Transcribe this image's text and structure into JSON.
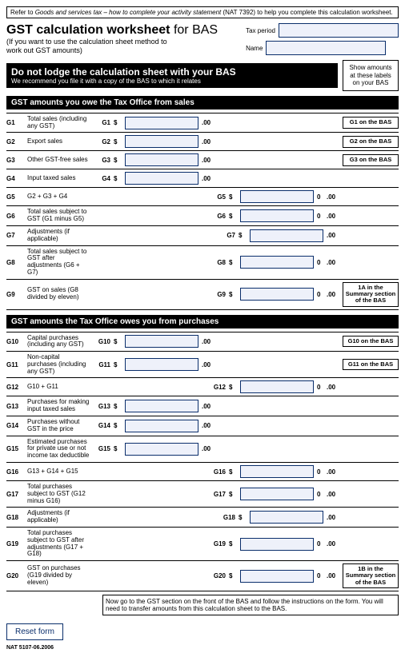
{
  "hint_pre": "Refer to ",
  "hint_em": "Goods and services tax – how to complete your activity statement",
  "hint_post": " (NAT 7392) to help you complete this calculation worksheet.",
  "title_bold": "GST calculation worksheet",
  "title_rest": " for BAS",
  "subtitle": "(If you want to use the calculation sheet method to work out GST amounts)",
  "taxperiod_label": "Tax period",
  "name_label": "Name",
  "warn_h": "Do not lodge the calculation sheet with your BAS",
  "warn_s": "We recommend you file it with a copy of the BAS to which it relates",
  "sidebox": "Show amounts at these labels on your BAS",
  "section1": "GST amounts you owe the Tax Office from sales",
  "section2": "GST amounts the Tax Office owes you from purchases",
  "dollar": "$",
  "cents": ".00",
  "zero": "0",
  "rows1": [
    {
      "g": "G1",
      "d": "Total sales (including any GST)",
      "rl": "G1",
      "lt": "left",
      "b": "G1 on the BAS"
    },
    {
      "g": "G2",
      "d": "Export sales",
      "rl": "G2",
      "lt": "left",
      "b": "G2 on the BAS"
    },
    {
      "g": "G3",
      "d": "Other GST-free sales",
      "rl": "G3",
      "lt": "left",
      "b": "G3 on the BAS"
    },
    {
      "g": "G4",
      "d": "Input taxed sales",
      "rl": "G4",
      "lt": "left",
      "b": ""
    },
    {
      "g": "G5",
      "d": "G2 + G3 + G4",
      "rl": "G5",
      "lt": "right",
      "b": "",
      "calc": true
    },
    {
      "g": "G6",
      "d": "Total sales subject to GST\n(G1 minus G5)",
      "rl": "G6",
      "lt": "right",
      "b": "",
      "calc": true
    },
    {
      "g": "G7",
      "d": "Adjustments (if applicable)",
      "rl": "G7",
      "lt": "right",
      "b": ""
    },
    {
      "g": "G8",
      "d": "Total sales subject to GST after adjustments\n(G6 + G7)",
      "rl": "G8",
      "lt": "right",
      "b": "",
      "calc": true
    },
    {
      "g": "G9",
      "d": "GST on sales (G8 divided by eleven)",
      "rl": "G9",
      "lt": "right",
      "b": "1A in the Summary section of the BAS",
      "calc": true
    }
  ],
  "rows2": [
    {
      "g": "G10",
      "d": "Capital purchases\n(including any GST)",
      "rl": "G10",
      "lt": "left",
      "b": "G10 on the BAS"
    },
    {
      "g": "G11",
      "d": "Non-capital purchases\n(including any GST)",
      "rl": "G11",
      "lt": "left",
      "b": "G11 on the BAS"
    },
    {
      "g": "G12",
      "d": "G10 + G11",
      "rl": "G12",
      "lt": "right",
      "b": "",
      "calc": true
    },
    {
      "g": "G13",
      "d": "Purchases for making input taxed sales",
      "rl": "G13",
      "lt": "left",
      "b": ""
    },
    {
      "g": "G14",
      "d": "Purchases without GST in the price",
      "rl": "G14",
      "lt": "left",
      "b": ""
    },
    {
      "g": "G15",
      "d": "Estimated purchases for private use\nor not income tax deductible",
      "rl": "G15",
      "lt": "left",
      "b": ""
    },
    {
      "g": "G16",
      "d": "G13 + G14 + G15",
      "rl": "G16",
      "lt": "right",
      "b": "",
      "calc": true
    },
    {
      "g": "G17",
      "d": "Total purchases subject to GST\n(G12 minus G16)",
      "rl": "G17",
      "lt": "right",
      "b": "",
      "calc": true
    },
    {
      "g": "G18",
      "d": "Adjustments (if applicable)",
      "rl": "G18",
      "lt": "right",
      "b": ""
    },
    {
      "g": "G19",
      "d": "Total purchases subject to GST after\nadjustments (G17 + G18)",
      "rl": "G19",
      "lt": "right",
      "b": "",
      "calc": true
    },
    {
      "g": "G20",
      "d": "GST on purchases (G19 divided by eleven)",
      "rl": "G20",
      "lt": "right",
      "b": "1B in the Summary section of the BAS",
      "calc": true
    }
  ],
  "note": "Now go to the GST section on the front of the BAS and follow the instructions on the form. You will need to transfer amounts from this calculation sheet to the BAS.",
  "reset": "Reset form",
  "foot": "NAT 5107-06.2006"
}
